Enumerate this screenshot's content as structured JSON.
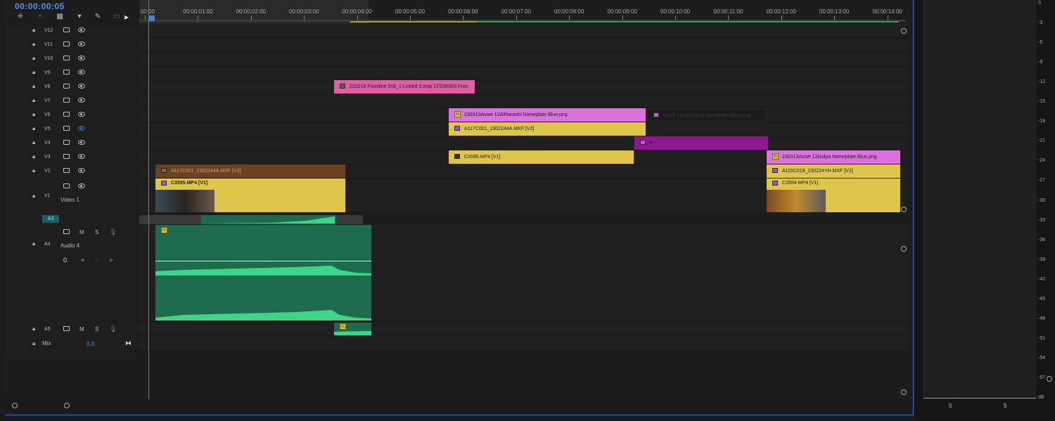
{
  "timecode": "00:00:00:05",
  "toolbar": {
    "icons": [
      "snap-icon",
      "magnet-icon",
      "linked-selection-icon",
      "marker-icon",
      "wrench-icon",
      "captions-icon"
    ]
  },
  "ruler": {
    "labels": [
      "00:00",
      "00:00:01:00",
      "00:00:02:00",
      "00:00:03:00",
      "00:00:04:00",
      "00:00:05:00",
      "00:00:06:00",
      "00:00:07:00",
      "00:00:08:00",
      "00:00:09:00",
      "00:00:10:00",
      "00:00:11:00",
      "00:00:12:00",
      "00:00:13:00",
      "00:00:14:00"
    ]
  },
  "video_tracks": [
    {
      "name": "V12"
    },
    {
      "name": "V11"
    },
    {
      "name": "V10"
    },
    {
      "name": "V9"
    },
    {
      "name": "V8"
    },
    {
      "name": "V7"
    },
    {
      "name": "V6"
    },
    {
      "name": "V5",
      "hidden": true
    },
    {
      "name": "V4"
    },
    {
      "name": "V3"
    },
    {
      "name": "V2"
    }
  ],
  "v1": {
    "name": "V1",
    "label": "Video 1"
  },
  "audio": {
    "a3_badge": "A3",
    "a4_name": "A4",
    "a4_label": "Audio 4",
    "m": "M",
    "s": "S",
    "vol": "0.",
    "a5_name": "A5",
    "mix_name": "Mix",
    "mix_value": "0.0"
  },
  "clips": {
    "v8_pink": "221018 Frontline DIS_1 Linked Comp 17/230303 Fron",
    "v6_violet": "230313Asset 12Allharashi Nameplate Blue.png",
    "v6_dim": "Asset 12Allharashi Nameplate Blue.png",
    "v5_yellow": "A117C001_2302244A.MXF [V2]",
    "v3_yellow": "C3595.MP4 [V1]",
    "v3_violet": "230313Asset 13Golpa Nameplate Blue.png",
    "v2_brown": "A117C001_2302244A.MXF [V2]",
    "v2_yellow": "A115C019_230224YH.MXF [V2]",
    "v1_clip1": "C3595.MP4 [V1]",
    "v1_clip2": "C3594.MP4 [V1]"
  },
  "meter_scale": [
    "0",
    "-3",
    "-6",
    "-9",
    "-12",
    "-15",
    "-18",
    "-21",
    "-24",
    "-27",
    "-30",
    "-33",
    "-36",
    "-39",
    "-42",
    "-45",
    "-48",
    "-51",
    "-54",
    "-57",
    "dB"
  ],
  "meter_buttons": [
    "S",
    "S"
  ],
  "colors": {
    "accent": "#5b8ff5",
    "pink": "#e05ea2",
    "violet": "#dc72df",
    "yellow": "#dec64a",
    "green": "#1e6b4b",
    "purple": "#8c1a8f"
  }
}
